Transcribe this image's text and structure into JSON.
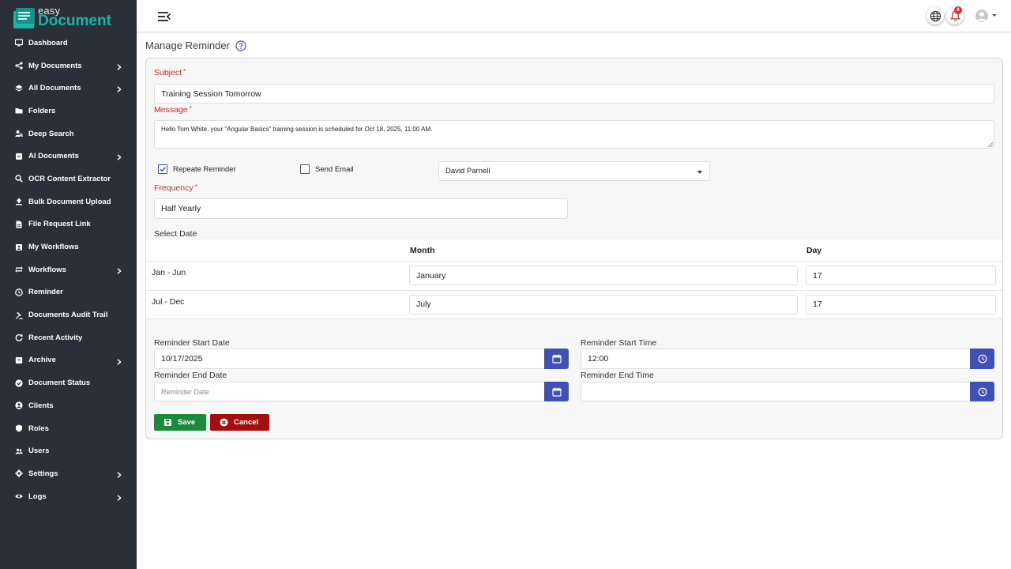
{
  "app": {
    "logo_top": "easy",
    "logo_main": "Document"
  },
  "sidebar": {
    "items": [
      {
        "label": "Dashboard",
        "icon": "monitor-icon",
        "chevron": false
      },
      {
        "label": "My Documents",
        "icon": "share-icon",
        "chevron": true
      },
      {
        "label": "All Documents",
        "icon": "layers-icon",
        "chevron": true
      },
      {
        "label": "Folders",
        "icon": "folder-icon",
        "chevron": false
      },
      {
        "label": "Deep Search",
        "icon": "person-search-icon",
        "chevron": false
      },
      {
        "label": "AI Documents",
        "icon": "ai-document-icon",
        "chevron": true
      },
      {
        "label": "OCR Content Extractor",
        "icon": "search-icon",
        "chevron": false
      },
      {
        "label": "Bulk Document Upload",
        "icon": "upload-icon",
        "chevron": false
      },
      {
        "label": "File Request Link",
        "icon": "file-icon",
        "chevron": false
      },
      {
        "label": "My Workflows",
        "icon": "workflow-icon",
        "chevron": false
      },
      {
        "label": "Workflows",
        "icon": "repeat-icon",
        "chevron": true
      },
      {
        "label": "Reminder",
        "icon": "clock-icon",
        "chevron": false
      },
      {
        "label": "Documents Audit Trail",
        "icon": "gavel-icon",
        "chevron": false
      },
      {
        "label": "Recent Activity",
        "icon": "refresh-icon",
        "chevron": false
      },
      {
        "label": "Archive",
        "icon": "archive-icon",
        "chevron": true
      },
      {
        "label": "Document Status",
        "icon": "check-circle-icon",
        "chevron": false
      },
      {
        "label": "Clients",
        "icon": "user-circle-icon",
        "chevron": false
      },
      {
        "label": "Roles",
        "icon": "shield-icon",
        "chevron": false
      },
      {
        "label": "Users",
        "icon": "users-icon",
        "chevron": false
      },
      {
        "label": "Settings",
        "icon": "gear-icon",
        "chevron": true
      },
      {
        "label": "Logs",
        "icon": "eye-icon",
        "chevron": true
      }
    ]
  },
  "topbar": {
    "notification_count": "8"
  },
  "page": {
    "title": "Manage Reminder"
  },
  "form": {
    "subject_label": "Subject",
    "subject_value": "Training Session Tomorrow",
    "message_label": "Message",
    "message_value": "Hello Tom White, your \"Angular Basics\" training session is scheduled for Oct 18, 2025, 11:00 AM.",
    "repeat_label": "Repeate Reminder",
    "repeat_checked": true,
    "send_email_label": "Send Email",
    "send_email_checked": false,
    "user_select_value": "David Parnell",
    "frequency_label": "Frequency",
    "frequency_value": "Half Yearly",
    "select_date_label": "Select Date",
    "table": {
      "col_month": "Month",
      "col_day": "Day",
      "rows": [
        {
          "period": "Jan - Jun",
          "month": "January",
          "day": "17"
        },
        {
          "period": "Jul - Dec",
          "month": "July",
          "day": "17"
        }
      ]
    },
    "start_date_label": "Reminder Start Date",
    "start_date_value": "10/17/2025",
    "start_time_label": "Reminder Start Time",
    "start_time_value": "12:00",
    "end_date_label": "Reminder End Date",
    "end_date_placeholder": "Reminder Date",
    "end_time_label": "Reminder End Time",
    "end_time_value": "",
    "save_label": "Save",
    "cancel_label": "Cancel"
  },
  "colors": {
    "sidebar_bg": "#2b2f3a",
    "accent_blue": "#3f51b5",
    "required_red": "#d32f2f",
    "save_green": "#1b8a3a",
    "cancel_red": "#a30f0f",
    "logo_teal": "#1bb5a8"
  }
}
